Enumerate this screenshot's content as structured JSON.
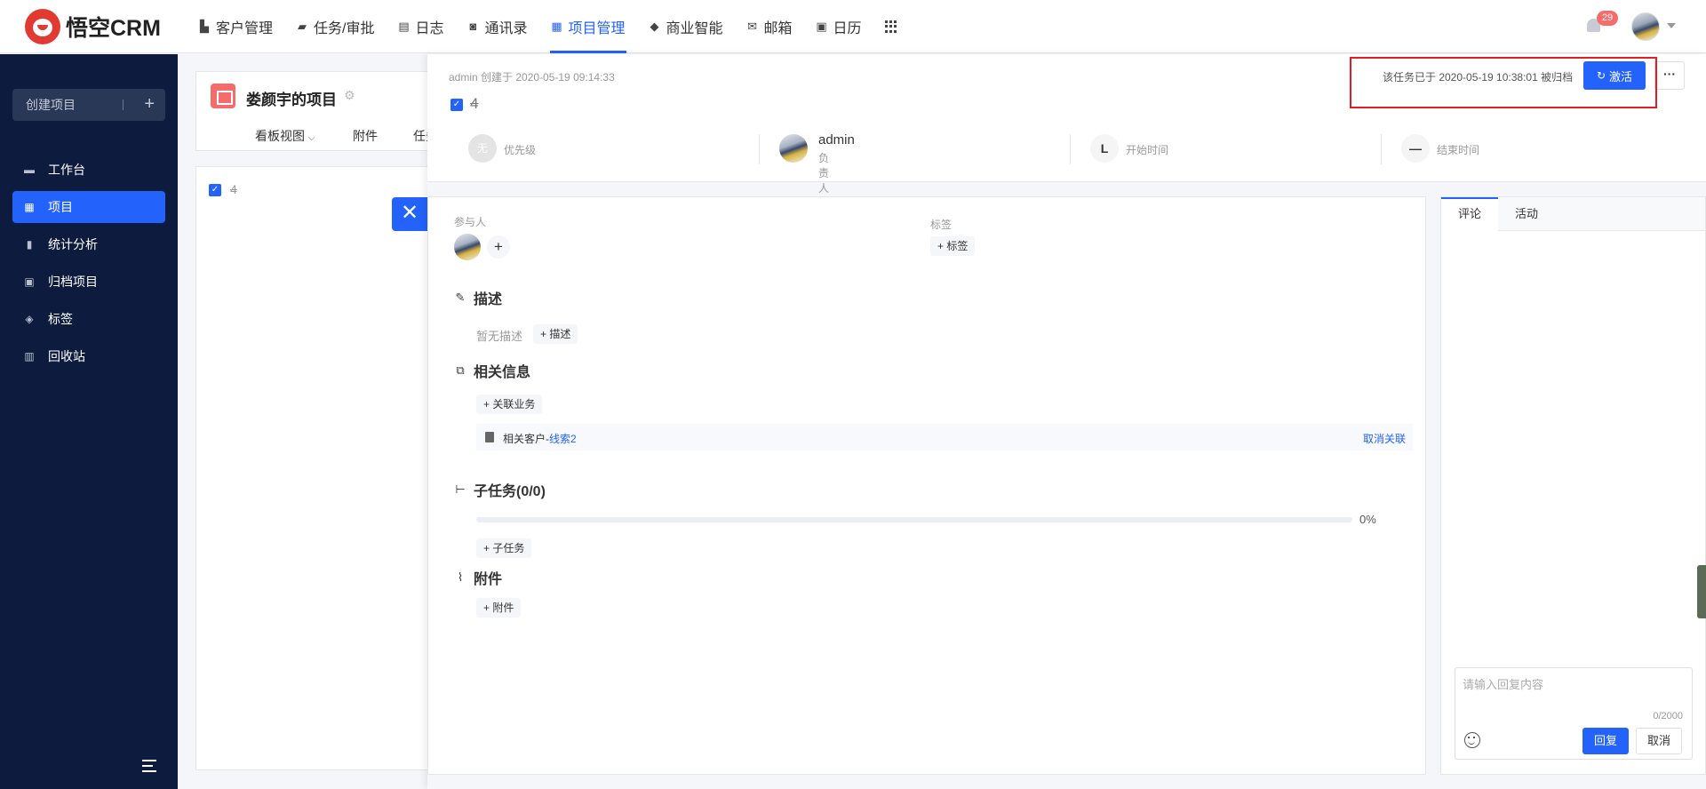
{
  "app": {
    "logo_text": "悟空CRM"
  },
  "nav": {
    "items": [
      {
        "label": "客户管理",
        "icon": "building-icon"
      },
      {
        "label": "任务/审批",
        "icon": "briefcase-icon"
      },
      {
        "label": "日志",
        "icon": "notebook-icon"
      },
      {
        "label": "通讯录",
        "icon": "contacts-icon"
      },
      {
        "label": "项目管理",
        "icon": "project-icon",
        "active": true
      },
      {
        "label": "商业智能",
        "icon": "chart-icon"
      },
      {
        "label": "邮箱",
        "icon": "mail-icon"
      },
      {
        "label": "日历",
        "icon": "calendar-icon"
      }
    ],
    "notification_count": "29"
  },
  "sidebar": {
    "create_label": "创建项目",
    "items": [
      {
        "label": "工作台",
        "icon": "monitor-icon"
      },
      {
        "label": "项目",
        "icon": "project-icon",
        "active": true
      },
      {
        "label": "统计分析",
        "icon": "bar-chart-icon"
      },
      {
        "label": "归档项目",
        "icon": "archive-icon"
      },
      {
        "label": "标签",
        "icon": "tags-icon"
      },
      {
        "label": "回收站",
        "icon": "trash-icon"
      }
    ]
  },
  "project": {
    "title": "娄颜宇的项目",
    "tabs": [
      "看板视图",
      "附件",
      "任务"
    ],
    "task_name": "4"
  },
  "task": {
    "creator": "admin 创建于 2020-05-19 09:14:33",
    "name": "4",
    "archive_notice": "该任务已于 2020-05-19 10:38:01 被归档",
    "activate_label": "激活",
    "more_label": "···",
    "priority_badge": "无",
    "priority_label": "优先级",
    "owner_name": "admin",
    "owner_role": "负责人",
    "start_icon_text": "L",
    "start_label": "开始时间",
    "end_icon_text": "—",
    "end_label": "结束时间"
  },
  "detail": {
    "participants_label": "参与人",
    "tags_label": "标签",
    "add_tag": "+ 标签",
    "description_title": "描述",
    "no_description": "暂无描述",
    "add_description": "+ 描述",
    "related_title": "相关信息",
    "link_business": "+ 关联业务",
    "related_prefix": "相关客户-",
    "related_link": "线索2",
    "unlink": "取消关联",
    "subtask_title": "子任务(0/0)",
    "progress": 0,
    "progress_text": "0%",
    "add_subtask": "+ 子任务",
    "attachment_title": "附件",
    "add_attachment": "+ 附件"
  },
  "comments": {
    "tabs": [
      "评论",
      "活动"
    ],
    "placeholder": "请输入回复内容",
    "counter": "0/2000",
    "reply_label": "回复",
    "cancel_label": "取消"
  },
  "colors": {
    "accent": "#2362fb",
    "sidebar": "#0d1b3e",
    "highlight": "#e51c23",
    "badge": "#f56c6c"
  }
}
